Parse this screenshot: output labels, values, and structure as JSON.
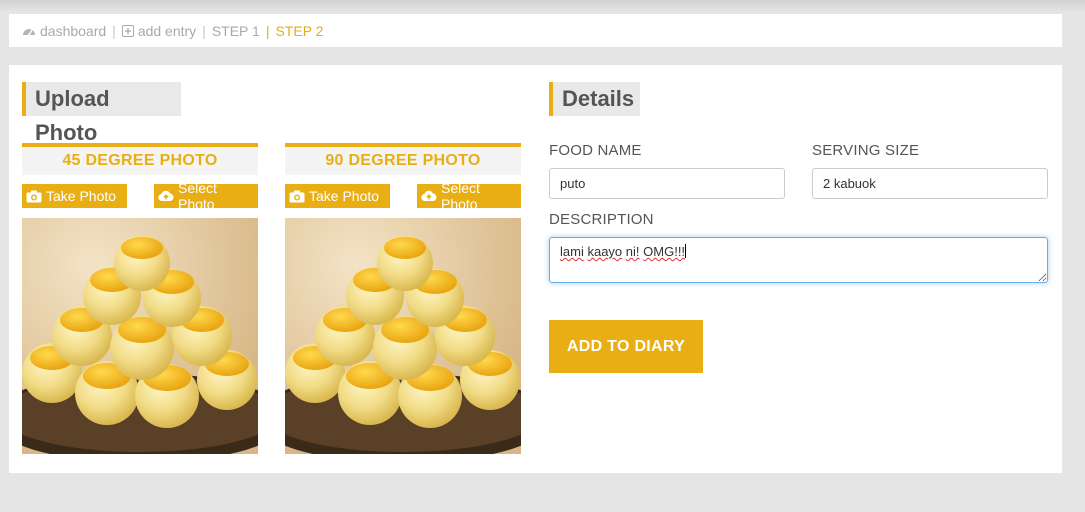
{
  "breadcrumb": {
    "items": [
      {
        "label": "dashboard",
        "icon": "dashboard-icon"
      },
      {
        "label": "add entry",
        "icon": "plus-square-icon"
      },
      {
        "label": "STEP 1"
      },
      {
        "label": "STEP 2",
        "active": true
      }
    ],
    "separator": "|"
  },
  "upload": {
    "title": "Upload Photo",
    "cards": [
      {
        "heading": "45 DEGREE PHOTO",
        "take_label": "Take Photo",
        "select_label": "Select Photo"
      },
      {
        "heading": "90 DEGREE PHOTO",
        "take_label": "Take Photo",
        "select_label": "Select Photo"
      }
    ]
  },
  "details": {
    "title": "Details",
    "food_name_label": "FOOD NAME",
    "food_name_value": "puto",
    "serving_size_label": "SERVING SIZE",
    "serving_size_value": "2 kabuok",
    "description_label": "DESCRIPTION",
    "description_words": [
      "lami",
      "kaayo",
      "ni!",
      "OMG!!!"
    ],
    "submit_label": "ADD TO DIARY"
  },
  "colors": {
    "accent": "#eaae15",
    "background": "#e5e5e5",
    "muted_text": "#a9a9a9"
  }
}
